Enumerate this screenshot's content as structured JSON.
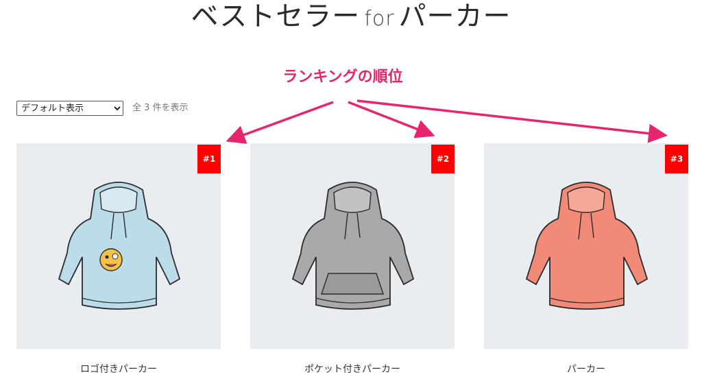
{
  "header": {
    "title_main": "ベストセラー",
    "title_for": "for",
    "title_sub": "パーカー"
  },
  "annotation": {
    "label": "ランキングの順位",
    "color": "#e8246e"
  },
  "toolbar": {
    "sort_selected": "デフォルト表示",
    "result_count": "全 3 件を表示"
  },
  "products": [
    {
      "rank": "#1",
      "name": "ロゴ付きパーカー",
      "color": "#bcdcea",
      "accent": "logo"
    },
    {
      "rank": "#2",
      "name": "ポケット付きパーカー",
      "color": "#a9a9a9",
      "accent": "pocket"
    },
    {
      "rank": "#3",
      "name": "パーカー",
      "color": "#f28a78",
      "accent": "plain"
    }
  ],
  "colors": {
    "badge": "#ff0000",
    "card_bg": "#e9edf1"
  }
}
